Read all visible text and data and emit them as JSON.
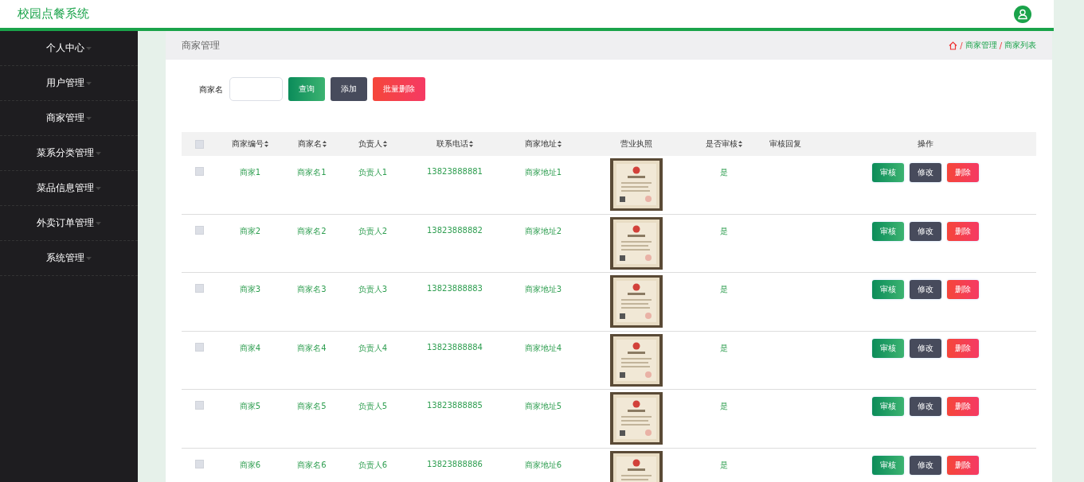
{
  "app": {
    "title": "校园点餐系统"
  },
  "sidebar": {
    "items": [
      {
        "label": "个人中心"
      },
      {
        "label": "用户管理"
      },
      {
        "label": "商家管理"
      },
      {
        "label": "菜系分类管理"
      },
      {
        "label": "菜品信息管理"
      },
      {
        "label": "外卖订单管理"
      },
      {
        "label": "系统管理"
      }
    ]
  },
  "breadcrumb": {
    "title": "商家管理",
    "separator": "/",
    "trail": [
      "商家管理",
      "商家列表"
    ]
  },
  "search": {
    "label": "商家名"
  },
  "toolbar": [
    {
      "label": "查询",
      "kind": "query"
    },
    {
      "label": "添加",
      "kind": "add"
    },
    {
      "label": "批量删除",
      "kind": "danger"
    }
  ],
  "table": {
    "select_all": {
      "checked": false
    },
    "columns": [
      {
        "label": "商家编号",
        "sortable": true
      },
      {
        "label": "商家名",
        "sortable": true
      },
      {
        "label": "负责人",
        "sortable": true
      },
      {
        "label": "联系电话",
        "sortable": true
      },
      {
        "label": "商家地址",
        "sortable": true
      },
      {
        "label": "营业执照",
        "sortable": false
      },
      {
        "label": "是否审核",
        "sortable": true
      },
      {
        "label": "审核回复",
        "sortable": false
      },
      {
        "label": "操作",
        "sortable": false
      }
    ],
    "rows": [
      {
        "checked": false,
        "cells": [
          "商家1",
          "商家名1",
          "负责人1",
          "13823888881",
          "商家地址1"
        ],
        "audit": "是",
        "actions": [
          {
            "label": "审核",
            "kind": "review"
          },
          {
            "label": "修改",
            "kind": "edit"
          },
          {
            "label": "删除",
            "kind": "delete"
          }
        ]
      },
      {
        "checked": false,
        "cells": [
          "商家2",
          "商家名2",
          "负责人2",
          "13823888882",
          "商家地址2"
        ],
        "audit": "是",
        "actions": [
          {
            "label": "审核",
            "kind": "review"
          },
          {
            "label": "修改",
            "kind": "edit"
          },
          {
            "label": "删除",
            "kind": "delete"
          }
        ]
      },
      {
        "checked": false,
        "cells": [
          "商家3",
          "商家名3",
          "负责人3",
          "13823888883",
          "商家地址3"
        ],
        "audit": "是",
        "actions": [
          {
            "label": "审核",
            "kind": "review"
          },
          {
            "label": "修改",
            "kind": "edit"
          },
          {
            "label": "删除",
            "kind": "delete"
          }
        ]
      },
      {
        "checked": false,
        "cells": [
          "商家4",
          "商家名4",
          "负责人4",
          "13823888884",
          "商家地址4"
        ],
        "audit": "是",
        "actions": [
          {
            "label": "审核",
            "kind": "review"
          },
          {
            "label": "修改",
            "kind": "edit"
          },
          {
            "label": "删除",
            "kind": "delete"
          }
        ]
      },
      {
        "checked": false,
        "cells": [
          "商家5",
          "商家名5",
          "负责人5",
          "13823888885",
          "商家地址5"
        ],
        "audit": "是",
        "actions": [
          {
            "label": "审核",
            "kind": "review"
          },
          {
            "label": "修改",
            "kind": "edit"
          },
          {
            "label": "删除",
            "kind": "delete"
          }
        ]
      },
      {
        "checked": false,
        "cells": [
          "商家6",
          "商家名6",
          "负责人6",
          "13823888886",
          "商家地址6"
        ],
        "audit": "是",
        "actions": [
          {
            "label": "审核",
            "kind": "review"
          },
          {
            "label": "修改",
            "kind": "edit"
          },
          {
            "label": "删除",
            "kind": "delete"
          }
        ]
      }
    ]
  }
}
